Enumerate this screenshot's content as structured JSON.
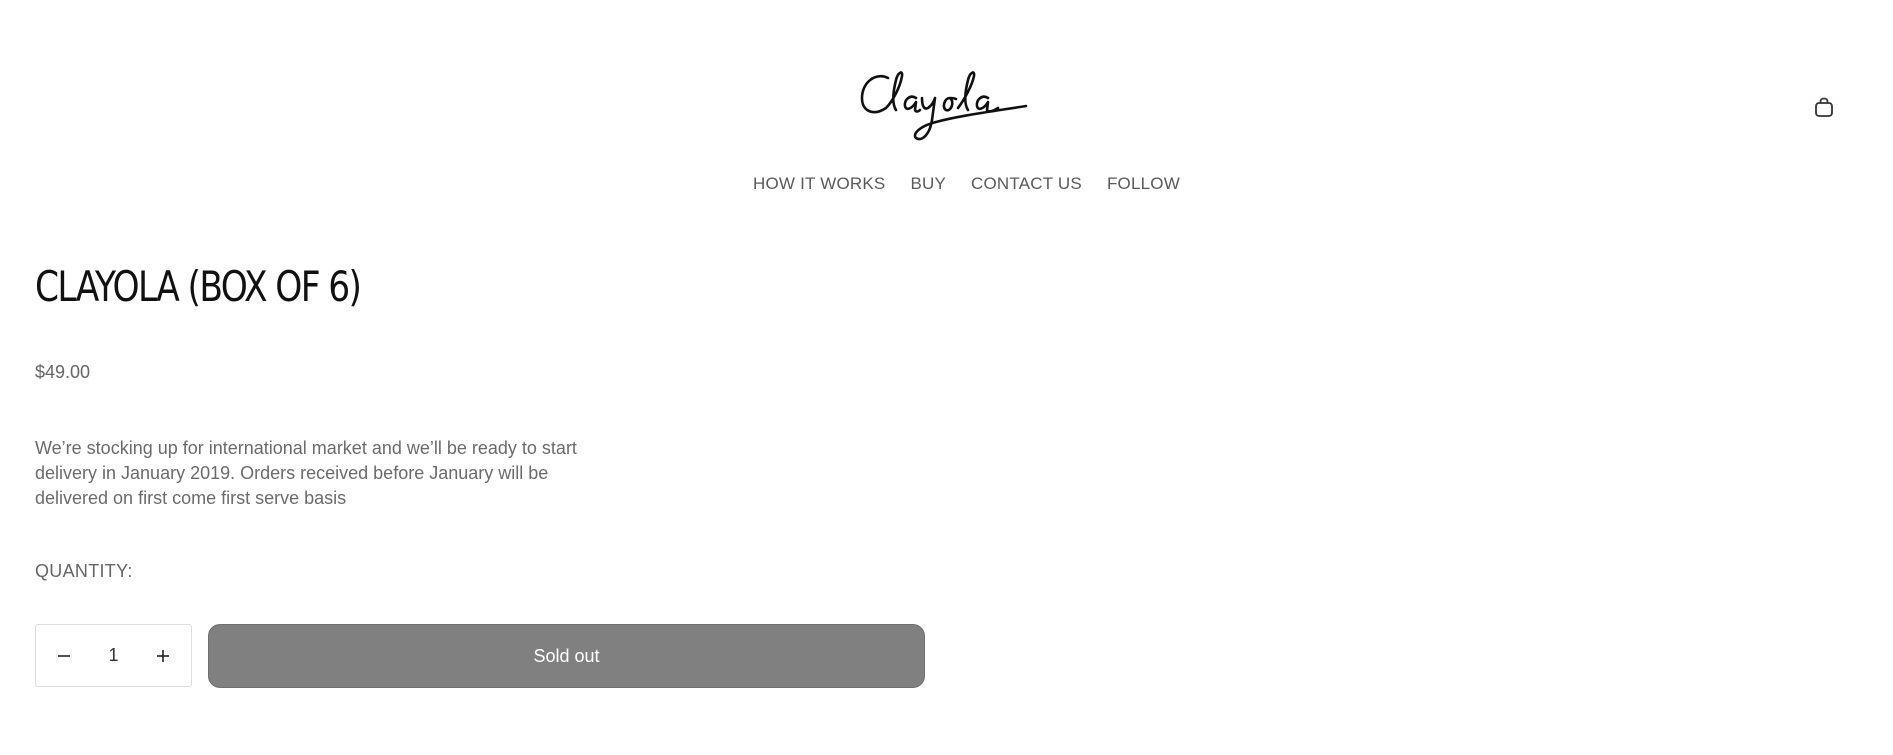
{
  "header": {
    "brand": "Clayola",
    "cart_icon": "shopping-bag-icon",
    "nav": [
      "HOW IT WORKS",
      "BUY",
      "CONTACT US",
      "FOLLOW"
    ]
  },
  "product": {
    "title": "CLAYOLA (BOX OF 6)",
    "price": "$49.00",
    "description": "We’re stocking up for international market and we’ll be ready to start delivery in January 2019. Orders received before January will be delivered on first come first serve basis",
    "quantity_label": "QUANTITY:",
    "quantity": {
      "value": "1",
      "decrement_icon": "minus-icon",
      "increment_icon": "plus-icon"
    },
    "button_label": "Sold out"
  },
  "colors": {
    "button_bg": "#808080",
    "text_muted": "#666666"
  }
}
